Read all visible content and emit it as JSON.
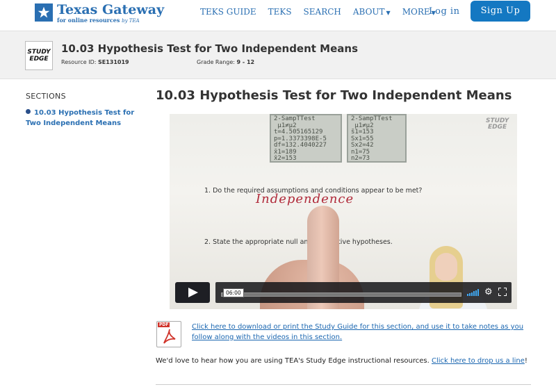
{
  "header": {
    "logo_title": "Texas Gateway",
    "logo_subtitle": "for online resources",
    "logo_by": "by TEA",
    "nav": [
      {
        "label": "TEKS GUIDE",
        "dropdown": false
      },
      {
        "label": "TEKS",
        "dropdown": false
      },
      {
        "label": "SEARCH",
        "dropdown": false
      },
      {
        "label": "ABOUT",
        "dropdown": true
      },
      {
        "label": "MORE",
        "dropdown": true
      }
    ],
    "login_label": "Log in",
    "signup_label": "Sign Up",
    "accent_color": "#1478c2"
  },
  "resource": {
    "logo_line1": "STUDY",
    "logo_line2": "EDGE",
    "title": "10.03 Hypothesis Test for Two Independent Means",
    "id_label": "Resource ID:",
    "id_value": "SE131019",
    "grade_label": "Grade Range:",
    "grade_value": "9 - 12"
  },
  "sidebar": {
    "heading": "SECTIONS",
    "items": [
      {
        "label": "10.03 Hypothesis Test for Two Independent Means"
      }
    ]
  },
  "main": {
    "title": "10.03 Hypothesis Test for Two Independent Means",
    "video": {
      "calc1_text": "2-SampTTest\n μ1≠μ2\nt=4.505165129\np=1.3373398E-5\ndf=132.4040227\nx̄1=189\nx̄2=153",
      "calc2_text": "2-SampTTest\n μ1≠μ2\ns̄1=153\nSx1=55\nSx2=42\nn1=75\nn2=73",
      "watermark_line1": "STUDY",
      "watermark_line2": "EDGE",
      "question1": "1.   Do the required assumptions and conditions appear to be met?",
      "handwriting": "Independence",
      "question2": "2.   State the appropriate null and alternative hypotheses.",
      "time": "06:00",
      "play_icon": "play-icon",
      "volume_icon": "volume-icon",
      "settings_icon": "gear-icon",
      "fullscreen_icon": "fullscreen-icon"
    },
    "study_guide_link": "Click here to download or print the Study Guide for this section, and use it to take notes as you follow along with the videos in this section.",
    "feedback_text": "We'd love to hear how you are using TEA's Study Edge instructional resources. ",
    "feedback_link": "Click here to drop us a line",
    "feedback_end": "!"
  }
}
